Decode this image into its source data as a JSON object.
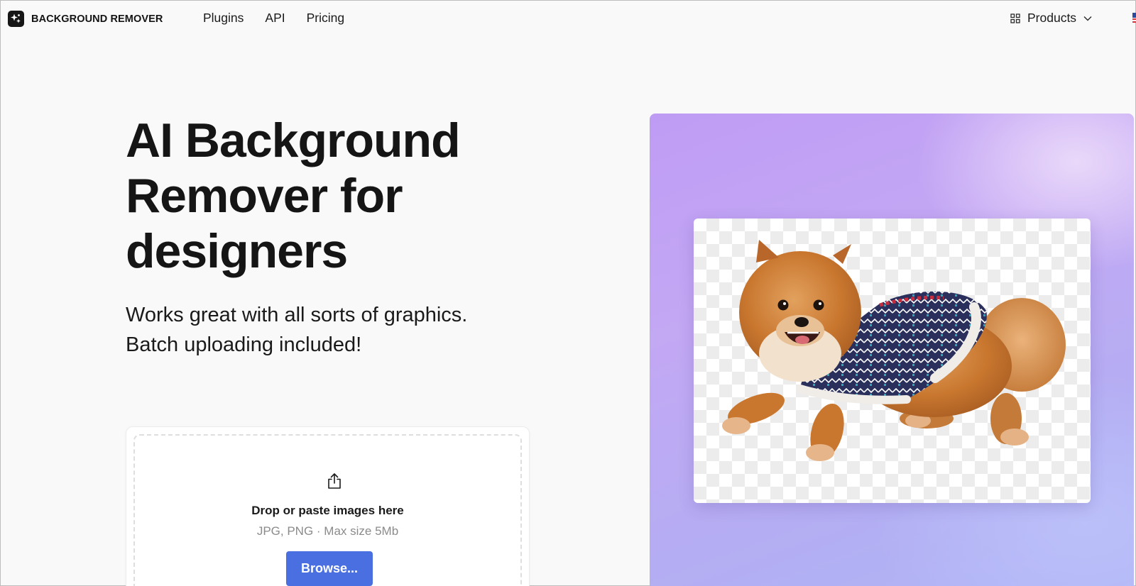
{
  "header": {
    "brand": "BACKGROUND REMOVER",
    "nav": [
      {
        "label": "Plugins"
      },
      {
        "label": "API"
      },
      {
        "label": "Pricing"
      }
    ],
    "products_label": "Products"
  },
  "hero": {
    "title_lines": [
      "AI Background",
      "Remover for",
      "designers"
    ],
    "subtitle_lines": [
      "Works great with all sorts of graphics.",
      "Batch uploading included!"
    ]
  },
  "upload": {
    "drop_label": "Drop or paste images here",
    "hint": "JPG, PNG · Max size 5Mb",
    "browse_label": "Browse..."
  },
  "icons": {
    "logo": "sparkle-logo-icon",
    "products": "grid-icon",
    "chevron": "chevron-down-icon",
    "upload": "share-upload-icon",
    "flag": "us-flag-icon"
  },
  "colors": {
    "accent": "#4a6fe0",
    "showcase_gradient_start": "#bf9cf4",
    "showcase_gradient_end": "#afb6f6",
    "text": "#141414"
  }
}
